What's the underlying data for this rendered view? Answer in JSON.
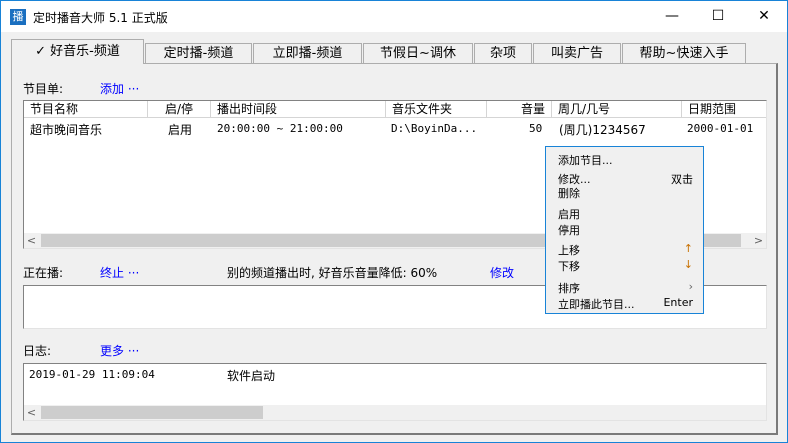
{
  "window": {
    "title": "定时播音大师 5.1 正式版",
    "icon": "播",
    "minimize": "—",
    "maximize": "☐",
    "close": "✕"
  },
  "tabs": [
    {
      "label": "✓ 好音乐-频道"
    },
    {
      "label": "定时播-频道"
    },
    {
      "label": "立即播-频道"
    },
    {
      "label": "节假日~调休"
    },
    {
      "label": "杂项"
    },
    {
      "label": "叫卖广告"
    },
    {
      "label": "帮助~快速入手"
    }
  ],
  "programs": {
    "label": "节目单:",
    "add_link": "添加 ···",
    "columns": [
      "节目名称",
      "启/停",
      "播出时间段",
      "音乐文件夹",
      "音量",
      "周几/几号",
      "日期范围"
    ],
    "rows": [
      {
        "name": "超市晚间音乐",
        "status": "启用",
        "time": "20:00:00 ~ 21:00:00",
        "folder": "D:\\BoyinDa...",
        "volume": "50",
        "days": "(周几)1234567",
        "date": "2000-01-01"
      }
    ]
  },
  "playing": {
    "label": "正在播:",
    "stop_link": "终止 ···",
    "note": "别的频道播出时, 好音乐音量降低: 60%",
    "modify_link": "修改"
  },
  "log": {
    "label": "日志:",
    "more_link": "更多 ···",
    "entries": [
      {
        "time": "2019-01-29 11:09:04",
        "message": "软件启动"
      }
    ]
  },
  "context_menu": {
    "items": [
      {
        "label": "添加节目...",
        "shortcut": ""
      },
      {
        "label": "修改...",
        "shortcut": "双击"
      },
      {
        "label": "删除",
        "shortcut": ""
      },
      {
        "label": "启用",
        "shortcut": ""
      },
      {
        "label": "停用",
        "shortcut": ""
      },
      {
        "label": "上移",
        "shortcut": "↑"
      },
      {
        "label": "下移",
        "shortcut": "↓"
      },
      {
        "label": "排序",
        "shortcut": "›"
      },
      {
        "label": "立即播此节目...",
        "shortcut": "Enter"
      }
    ]
  }
}
